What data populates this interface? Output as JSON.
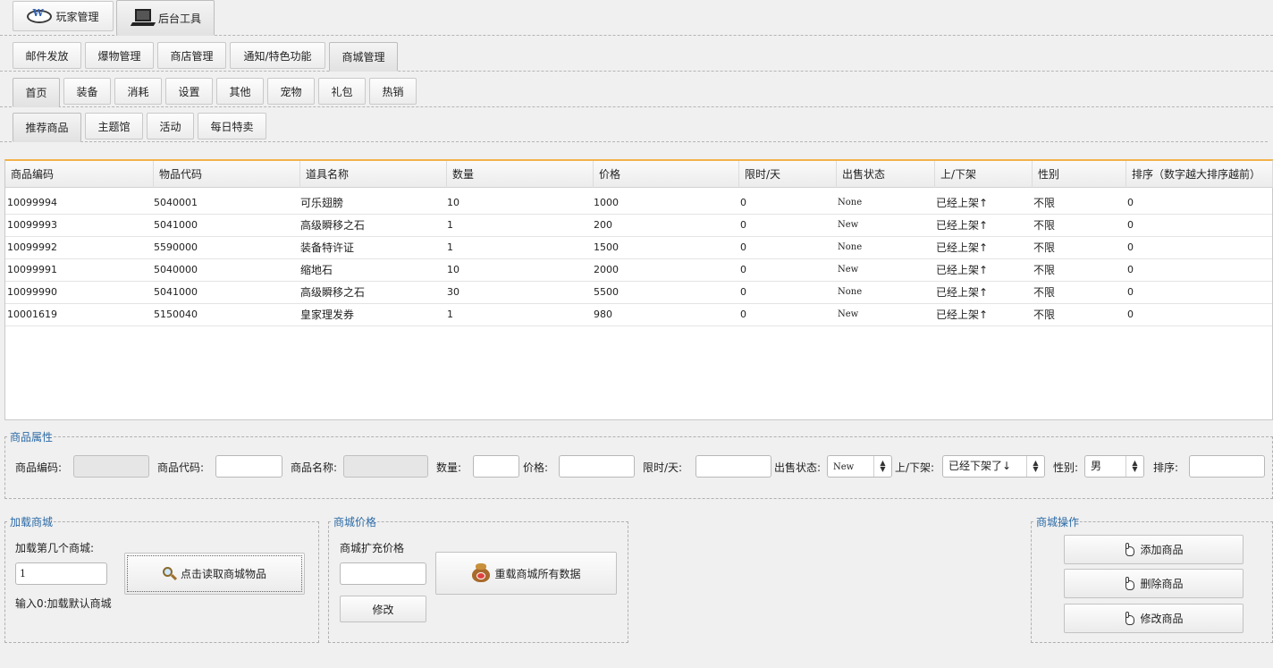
{
  "top_tabs": [
    {
      "label": "玩家管理",
      "icon": "wps-logo-icon"
    },
    {
      "label": "后台工具",
      "icon": "computer-icon"
    }
  ],
  "sub_tabs": [
    "邮件发放",
    "爆物管理",
    "商店管理",
    "通知/特色功能",
    "商城管理"
  ],
  "cat_tabs": [
    "首页",
    "装备",
    "消耗",
    "设置",
    "其他",
    "宠物",
    "礼包",
    "热销"
  ],
  "page_tabs": [
    "推荐商品",
    "主题馆",
    "活动",
    "每日特卖"
  ],
  "table": {
    "headers": [
      "商品编码",
      "物品代码",
      "道具名称",
      "数量",
      "价格",
      "限时/天",
      "出售状态",
      "上/下架",
      "性别",
      "排序（数字越大排序越前）"
    ],
    "rows": [
      [
        "10099994",
        "5040001",
        "可乐翅膀",
        "10",
        "1000",
        "0",
        "None",
        "已经上架↑",
        "不限",
        "0"
      ],
      [
        "10099993",
        "5041000",
        "高级瞬移之石",
        "1",
        "200",
        "0",
        "New",
        "已经上架↑",
        "不限",
        "0"
      ],
      [
        "10099992",
        "5590000",
        "装备特许证",
        "1",
        "1500",
        "0",
        "None",
        "已经上架↑",
        "不限",
        "0"
      ],
      [
        "10099991",
        "5040000",
        "缩地石",
        "10",
        "2000",
        "0",
        "New",
        "已经上架↑",
        "不限",
        "0"
      ],
      [
        "10099990",
        "5041000",
        "高级瞬移之石",
        "30",
        "5500",
        "0",
        "None",
        "已经上架↑",
        "不限",
        "0"
      ],
      [
        "10001619",
        "5150040",
        "皇家理发券",
        "1",
        "980",
        "0",
        "New",
        "已经上架↑",
        "不限",
        "0"
      ]
    ]
  },
  "props": {
    "legend": "商品属性",
    "code_label": "商品编码:",
    "item_code_label": "商品代码:",
    "name_label": "商品名称:",
    "qty_label": "数量:",
    "price_label": "价格:",
    "limit_label": "限时/天:",
    "sale_label": "出售状态:",
    "sale_value": "New",
    "shelf_label": "上/下架:",
    "shelf_value": "已经下架了↓",
    "gender_label": "性别:",
    "gender_value": "男",
    "sort_label": "排序:"
  },
  "load": {
    "legend": "加载商城",
    "which_label": "加载第几个商城:",
    "which_value": "1",
    "read_button": "点击读取商城物品",
    "hint": "输入0:加载默认商城"
  },
  "price": {
    "legend": "商城价格",
    "extra_label": "商城扩充价格",
    "reload_button": "重载商城所有数据",
    "modify_button": "修改"
  },
  "ops": {
    "legend": "商城操作",
    "add_button": "添加商品",
    "delete_button": "删除商品",
    "edit_button": "修改商品"
  }
}
